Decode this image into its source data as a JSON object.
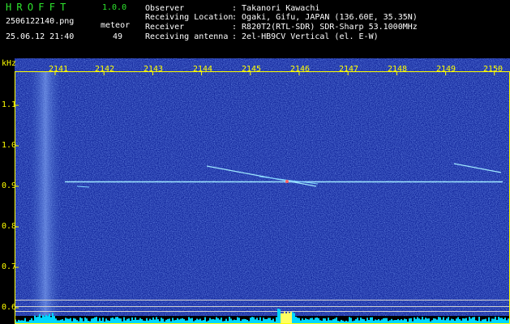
{
  "header": {
    "app_name": "HROFFT",
    "version": "1.0.0",
    "filename": "2506122140.png",
    "datetime": "25.06.12 21:40",
    "meteor_label": "meteor",
    "meteor_count": "49"
  },
  "info": {
    "observer_label": "Observer",
    "observer_value": ": Takanori Kawachi",
    "location_label": "Receiving Location",
    "location_value": ": Ogaki, Gifu, JAPAN (136.60E, 35.35N)",
    "receiver_label": "Receiver",
    "receiver_value": ": R820T2(RTL-SDR) SDR-Sharp 53.1000MHz",
    "antenna_label": "Receiving antenna",
    "antenna_value": ": 2el-HB9CV Vertical (el. E-W)"
  },
  "axes": {
    "unit": "kHz",
    "time_ticks": [
      "2141",
      "2142",
      "2143",
      "2144",
      "2145",
      "2146",
      "2147",
      "2148",
      "2149",
      "2150"
    ],
    "freq_ticks": [
      "1.1",
      "1.0",
      "0.9",
      "0.8",
      "0.7",
      "0.6"
    ]
  },
  "colors": {
    "title_green": "#2ee62e",
    "label_yellow": "#ffff00",
    "background_blue": "#10249a",
    "signal_cyan": "#9fe7ff",
    "level_bar_cyan": "#00d6ff"
  }
}
